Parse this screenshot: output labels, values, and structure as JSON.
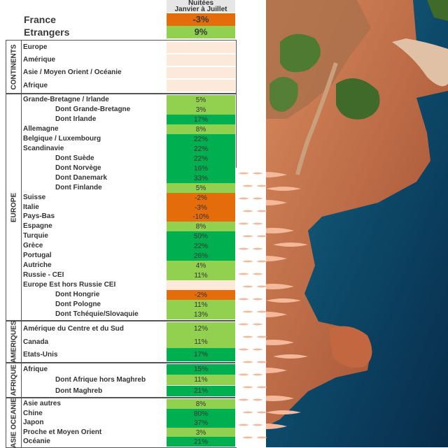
{
  "header": {
    "col_title_top": "Nuitées",
    "col_title": "Janvier à Juillet"
  },
  "top": [
    {
      "label": "France",
      "value": "-3%",
      "color": "orange"
    },
    {
      "label": "Etrangers",
      "value": "9%",
      "color": "green"
    }
  ],
  "sections": {
    "continents": {
      "label": "CONTINENTS",
      "rows": [
        {
          "name": "Europe",
          "value": ""
        },
        {
          "name": "Amérique",
          "value": ""
        },
        {
          "name": "Asie / Moyen Orient / Océanie",
          "value": ""
        },
        {
          "name": "Afrique",
          "value": ""
        }
      ]
    },
    "europe": {
      "label": "EUROPE",
      "rows": [
        {
          "name": "Grande-Bretagne / Irlande",
          "value": "5%",
          "indent": false,
          "color": "light"
        },
        {
          "name": "Dont Grande-Bretagne",
          "value": "3%",
          "indent": true,
          "color": "light"
        },
        {
          "name": "Dont Irlande",
          "value": "17%",
          "indent": true,
          "color": "dark"
        },
        {
          "name": "Allemagne",
          "value": "8%",
          "indent": false,
          "color": "light"
        },
        {
          "name": "Belgique / Luxembourg",
          "value": "22%",
          "indent": false,
          "color": "dark"
        },
        {
          "name": "Scandinavie",
          "value": "22%",
          "indent": false,
          "color": "dark"
        },
        {
          "name": "Dont Suède",
          "value": "22%",
          "indent": true,
          "color": "dark"
        },
        {
          "name": "Dont Norvège",
          "value": "16%",
          "indent": true,
          "color": "dark"
        },
        {
          "name": "Dont Danemark",
          "value": "33%",
          "indent": true,
          "color": "dark"
        },
        {
          "name": "Dont Finlande",
          "value": "5%",
          "indent": true,
          "color": "light"
        },
        {
          "name": "Suisse",
          "value": "-2%",
          "indent": false,
          "color": "orange"
        },
        {
          "name": "Italie",
          "value": "-3%",
          "indent": false,
          "color": "orange"
        },
        {
          "name": "Pays-Bas",
          "value": "-10%",
          "indent": false,
          "color": "orange"
        },
        {
          "name": "Espagne",
          "value": "8%",
          "indent": false,
          "color": "light"
        },
        {
          "name": "Turquie",
          "value": "50%",
          "indent": false,
          "color": "dark"
        },
        {
          "name": "Grèce",
          "value": "22%",
          "indent": false,
          "color": "dark"
        },
        {
          "name": "Portugal",
          "value": "26%",
          "indent": false,
          "color": "dark"
        },
        {
          "name": "Autriche",
          "value": "4%",
          "indent": false,
          "color": "light"
        },
        {
          "name": "Russie - CEI",
          "value": "11%",
          "indent": false,
          "color": "light"
        },
        {
          "name": "Europe Est hors Russie CEI",
          "value": "",
          "indent": false,
          "color": "peach"
        },
        {
          "name": "Dont Hongrie",
          "value": "-2%",
          "indent": true,
          "color": "orange"
        },
        {
          "name": "Dont Pologne",
          "value": "11%",
          "indent": true,
          "color": "light"
        },
        {
          "name": "Dont Tchéquie/Slovaquie",
          "value": "13%",
          "indent": true,
          "color": "light"
        }
      ]
    },
    "ameriques": {
      "label": "AMERIQUES",
      "rows": [
        {
          "name": "Amérique du Centre et du Sud",
          "value": "12%",
          "indent": false,
          "color": "light"
        },
        {
          "name": "Canada",
          "value": "11%",
          "indent": false,
          "color": "light"
        },
        {
          "name": "Etats-Unis",
          "value": "17%",
          "indent": false,
          "color": "dark"
        }
      ]
    },
    "afrique": {
      "label": "AFRIQUE",
      "rows": [
        {
          "name": "Afrique",
          "value": "15%",
          "indent": false,
          "color": "dark"
        },
        {
          "name": "Dont Afrique hors Maghreb",
          "value": "11%",
          "indent": true,
          "color": "light"
        },
        {
          "name": "Dont Maghreb",
          "value": "21%",
          "indent": true,
          "color": "dark"
        }
      ]
    },
    "asie": {
      "label": "ASIE OCEANIE",
      "rows": [
        {
          "name": "Asie autres",
          "value": "8%",
          "indent": false,
          "color": "light"
        },
        {
          "name": "Chine",
          "value": "80%",
          "indent": false,
          "color": "dark"
        },
        {
          "name": "Japon",
          "value": "37%",
          "indent": false,
          "color": "dark"
        },
        {
          "name": "Proche et Moyen Orient",
          "value": "3%",
          "indent": false,
          "color": "light"
        },
        {
          "name": "Océanie",
          "value": "21%",
          "indent": false,
          "color": "dark"
        }
      ]
    }
  },
  "colors": {
    "orange": "#e46c0a",
    "light": "#92d050",
    "dark": "#00b050",
    "peach": "#fde9d9"
  }
}
